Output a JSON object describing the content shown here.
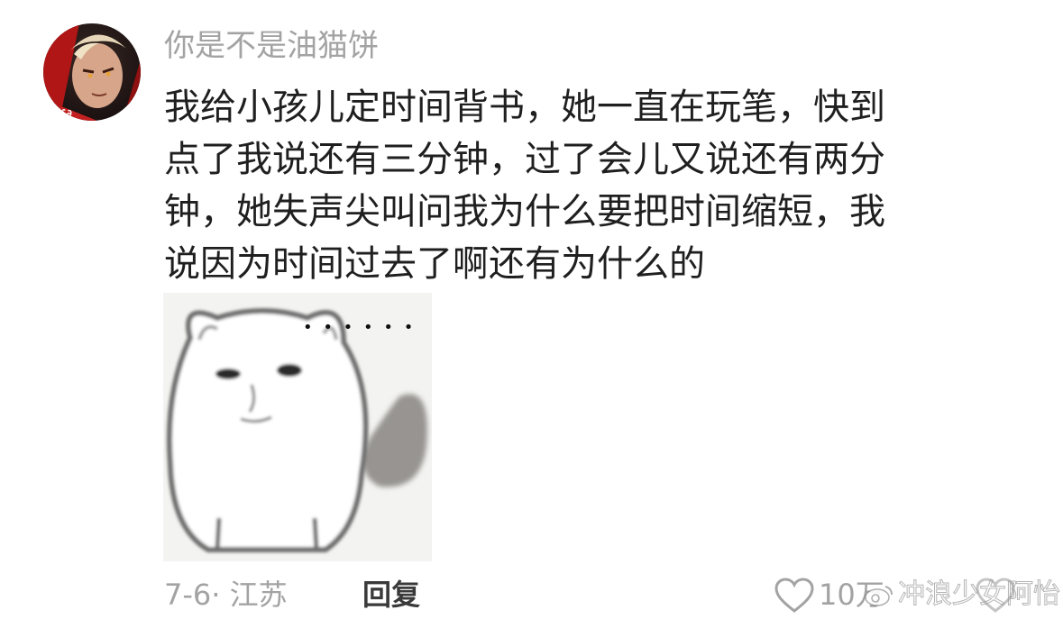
{
  "comment": {
    "username": "你是不是油猫饼",
    "content_lines": [
      "我给小孩儿定时间背书，她一直在玩笔，快到",
      "点了我说还有三分钟，过了会儿又说还有两分",
      "钟，她失声尖叫问我为什么要把时间缩短，我",
      "说因为时间过去了啊还有为什么的"
    ],
    "sticker": {
      "dots": "• • • • • •"
    },
    "footer": {
      "date_location": "7-6· 江苏",
      "reply_label": "回复",
      "like_count": "10万"
    }
  },
  "watermark": {
    "text": "冲浪少女阿怡"
  },
  "icons": {
    "avatar": "avatar-image",
    "like": "heart-outline-icon",
    "watermark_logo": "weibo-logo-icon"
  },
  "colors": {
    "text_primary": "#1f1f1f",
    "text_secondary": "#a3a3a3",
    "reply": "#3a3a3a"
  }
}
